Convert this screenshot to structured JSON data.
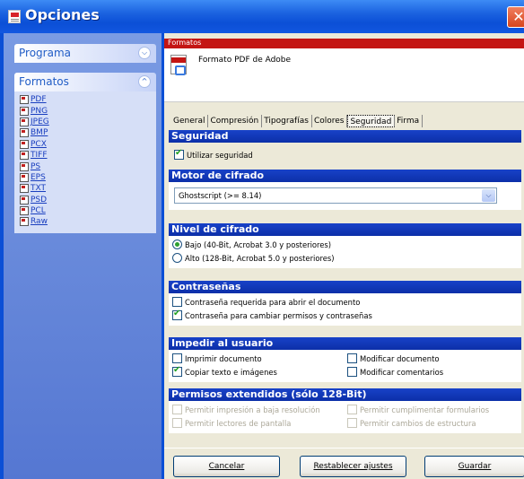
{
  "window": {
    "title": "Opciones",
    "close_label": "✕"
  },
  "sidebar": {
    "programa_label": "Programa",
    "formatos_label": "Formatos",
    "formats": [
      "PDF",
      "PNG",
      "JPEG",
      "BMP",
      "PCX",
      "TIFF",
      "PS",
      "EPS",
      "TXT",
      "PSD",
      "PCL",
      "Raw"
    ]
  },
  "content": {
    "section_title": "Formatos",
    "format_description": "Formato PDF de Adobe",
    "tabs": [
      {
        "label": "General",
        "active": false
      },
      {
        "label": "Compresión",
        "active": false
      },
      {
        "label": "Tipografías",
        "active": false
      },
      {
        "label": "Colores",
        "active": false
      },
      {
        "label": "Seguridad",
        "active": true
      },
      {
        "label": "Firma",
        "active": false
      }
    ],
    "security": {
      "header": "Seguridad",
      "use_security": {
        "label": "Utilizar seguridad",
        "checked": true
      }
    },
    "encryption_engine": {
      "header": "Motor de cifrado",
      "selected": "Ghostscript (>= 8.14)"
    },
    "encryption_level": {
      "header": "Nivel de cifrado",
      "options": [
        {
          "label": "Bajo (40-Bit, Acrobat 3.0 y posteriores)",
          "selected": true
        },
        {
          "label": "Alto (128-Bit, Acrobat 5.0 y posteriores)",
          "selected": false
        }
      ]
    },
    "passwords": {
      "header": "Contraseñas",
      "open_password": {
        "label": "Contraseña requerida para abrir el documento",
        "checked": false
      },
      "permissions_password": {
        "label": "Contraseña para cambiar permisos y contraseñas",
        "checked": true
      }
    },
    "restrictions": {
      "header": "Impedir al usuario",
      "print": {
        "label": "Imprimir documento",
        "checked": false
      },
      "modify": {
        "label": "Modificar documento",
        "checked": false
      },
      "copy": {
        "label": "Copiar texto e imágenes",
        "checked": true
      },
      "comments": {
        "label": "Modificar comentarios",
        "checked": false
      }
    },
    "extended": {
      "header": "Permisos extendidos (sólo 128-Bit)",
      "low_res_print": {
        "label": "Permitir impresión a baja resolución",
        "checked": false
      },
      "fill_forms": {
        "label": "Permitir cumplimentar formularios",
        "checked": false
      },
      "screen_readers": {
        "label": "Permitir lectores de pantalla",
        "checked": false
      },
      "structure": {
        "label": "Permitir cambios de estructura",
        "checked": false
      }
    }
  },
  "buttons": {
    "cancel": "Cancelar",
    "reset": "Restablecer ajustes",
    "save": "Guardar"
  }
}
